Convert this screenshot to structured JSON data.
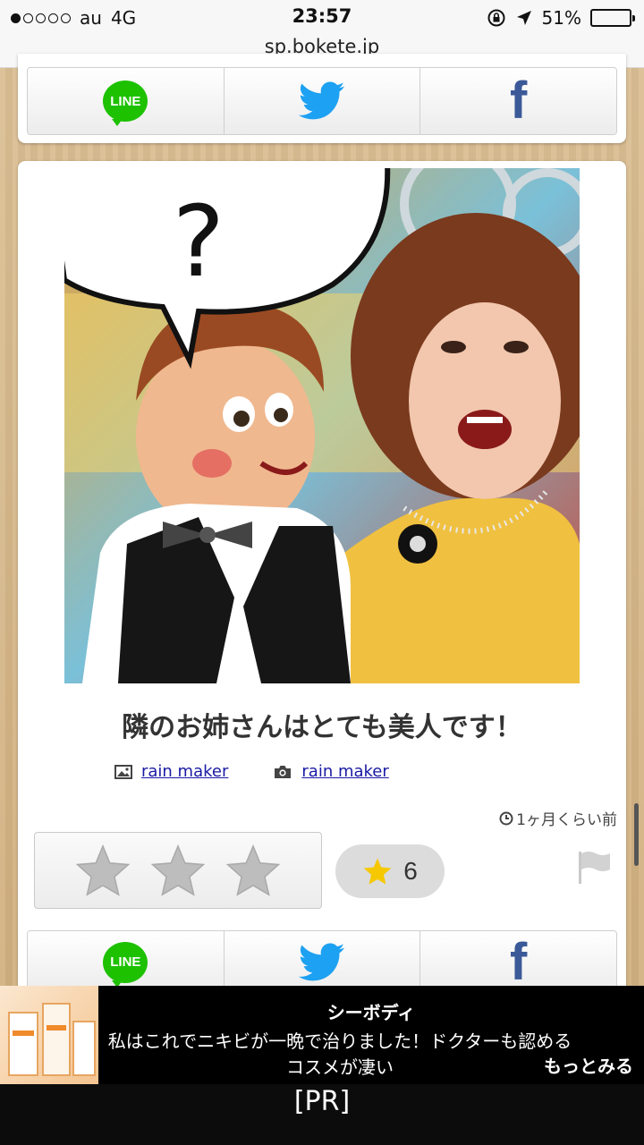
{
  "status_bar": {
    "carrier": "au",
    "network": "4G",
    "time": "23:57",
    "battery": "51%",
    "battery_level": 0.51,
    "signal_bars_filled": 1,
    "signal_bars_total": 5,
    "url": "sp.bokete.jp"
  },
  "share": {
    "line_label": "LINE",
    "twitter": "twitter-bird-icon",
    "facebook_label": "f"
  },
  "post": {
    "speech_bubble_text": "?",
    "caption": "隣のお姉さんはとても美人です！",
    "image_author": "rain maker",
    "photo_author": "rain maker",
    "time_ago": "1ヶ月くらい前",
    "star_count": "6",
    "rating_stars": 3
  },
  "ad": {
    "title": "シーボディ",
    "body": "私はこれでニキビが一晩で治りました！ドクターも認めるコスメが凄い",
    "more_label": "もっとみる",
    "pr_label": "[PR]"
  },
  "colors": {
    "line_green": "#1dc100",
    "twitter_blue": "#1da1f2",
    "facebook_blue": "#3b5998",
    "link_blue": "#1a1aa6",
    "star_yellow": "#f6c800"
  }
}
